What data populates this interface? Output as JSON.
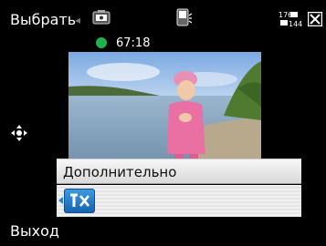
{
  "softkeys": {
    "left_label": "Выбрать",
    "right_label": "Выход"
  },
  "status": {
    "remaining": "67:18",
    "indicator_color": "#1fb24a"
  },
  "indicators": {
    "camera_mode_icon": "video-camera-icon",
    "flash_icon": "flash-icon",
    "resolution_icon": "resolution-icon",
    "resolution_top": "176",
    "resolution_bottom": "144",
    "close_icon": "close-icon"
  },
  "menu": {
    "header_label": "Дополнительно",
    "items": [
      {
        "icon": "settings-tools-icon",
        "selected": true
      }
    ]
  }
}
